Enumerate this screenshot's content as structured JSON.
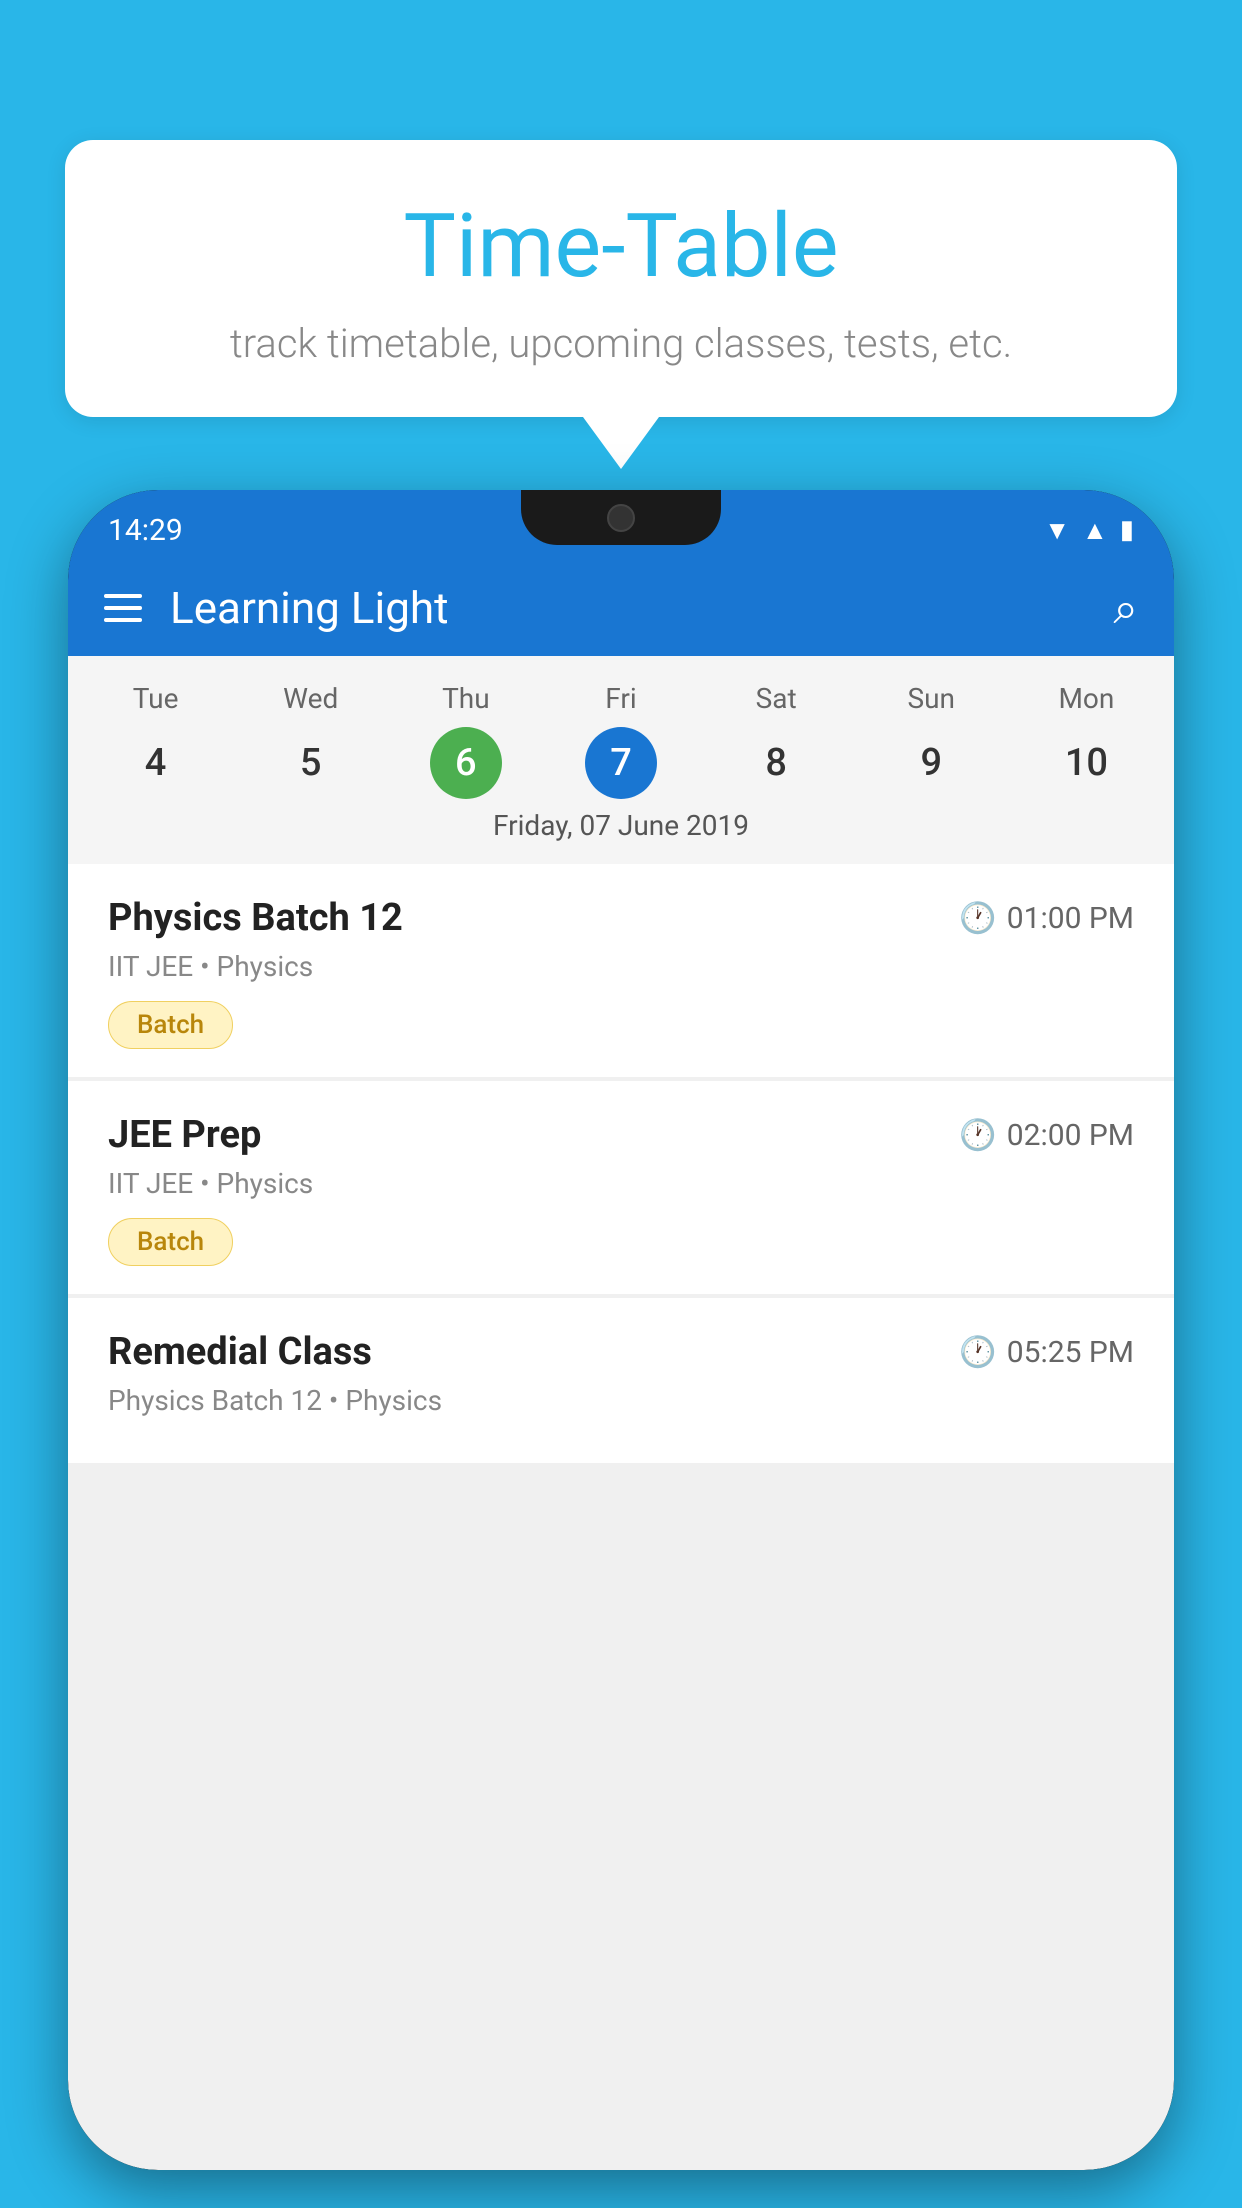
{
  "background_color": "#29B6E8",
  "bubble": {
    "title": "Time-Table",
    "subtitle": "track timetable, upcoming classes, tests, etc."
  },
  "phone": {
    "status_bar": {
      "time": "14:29"
    },
    "app_bar": {
      "title": "Learning Light"
    },
    "calendar": {
      "days": [
        "Tue",
        "Wed",
        "Thu",
        "Fri",
        "Sat",
        "Sun",
        "Mon"
      ],
      "dates": [
        "4",
        "5",
        "6",
        "7",
        "8",
        "9",
        "10"
      ],
      "today_index": 2,
      "selected_index": 3,
      "date_label": "Friday, 07 June 2019"
    },
    "schedule": [
      {
        "title": "Physics Batch 12",
        "time": "01:00 PM",
        "sub": "IIT JEE • Physics",
        "badge": "Batch"
      },
      {
        "title": "JEE Prep",
        "time": "02:00 PM",
        "sub": "IIT JEE • Physics",
        "badge": "Batch"
      },
      {
        "title": "Remedial Class",
        "time": "05:25 PM",
        "sub": "Physics Batch 12 • Physics",
        "badge": ""
      }
    ]
  }
}
